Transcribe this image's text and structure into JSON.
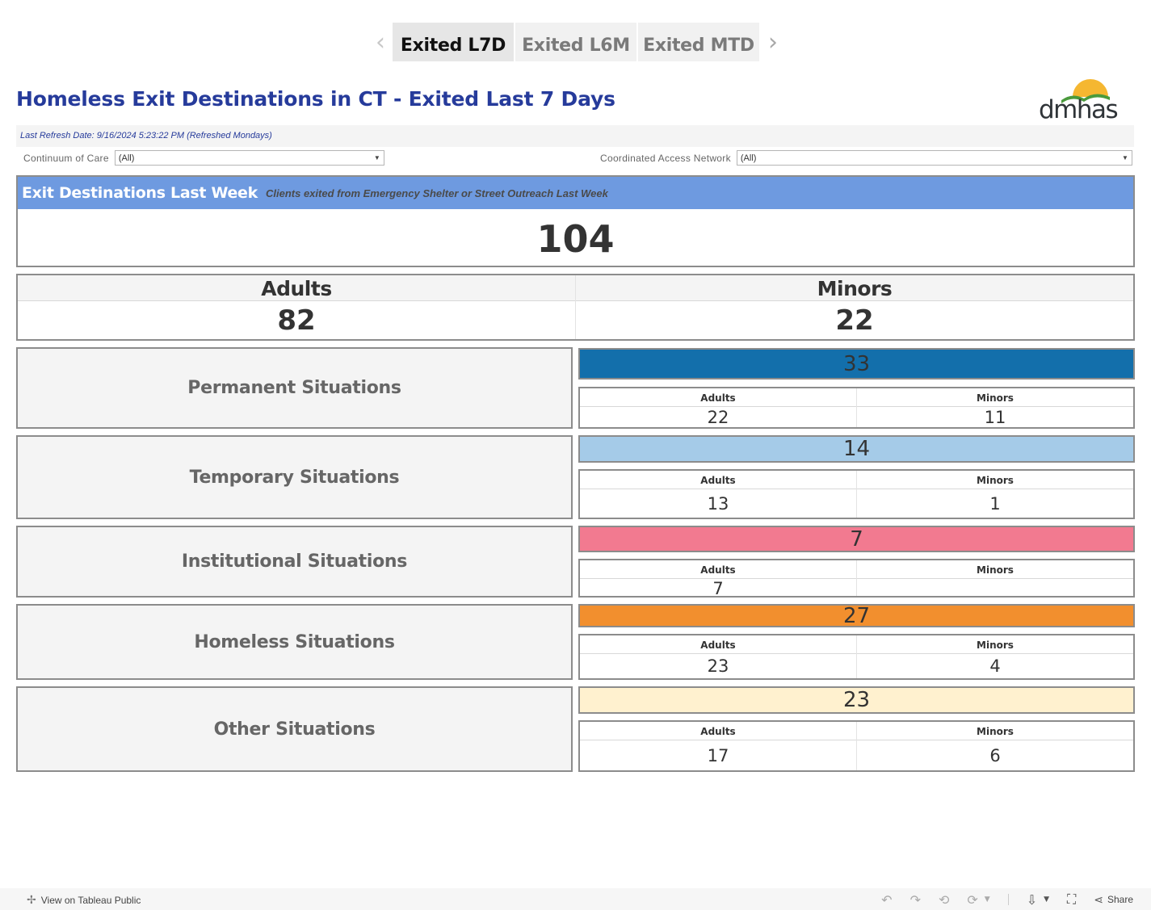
{
  "tabs": {
    "items": [
      {
        "label": "Exited L7D",
        "active": true
      },
      {
        "label": "Exited L6M",
        "active": false
      },
      {
        "label": "Exited MTD",
        "active": false
      }
    ],
    "prev_icon": "‹",
    "next_icon": "›"
  },
  "header": {
    "title": "Homeless Exit Destinations in CT - Exited Last 7 Days",
    "logo_text": "dmhas",
    "refresh_text": "Last Refresh Date: 9/16/2024 5:23:22 PM (Refreshed Mondays)"
  },
  "filters": {
    "continuum": {
      "label": "Continuum of Care",
      "value": "(All)"
    },
    "can": {
      "label": "Coordinated Access Network",
      "value": "(All)"
    },
    "arrow_icon": "▼"
  },
  "kpi": {
    "title": "Exit Destinations Last Week",
    "subtitle": "Clients exited from Emergency Shelter or Street Outreach Last Week",
    "value": "104"
  },
  "totals": {
    "adults_label": "Adults",
    "minors_label": "Minors",
    "adults_value": "82",
    "minors_value": "22"
  },
  "categories": [
    {
      "label": "Permanent Situations",
      "total": "33",
      "adults_label": "Adults",
      "minors_label": "Minors",
      "adults": "22",
      "minors": "11",
      "color": "#136fab"
    },
    {
      "label": "Temporary Situations",
      "total": "14",
      "adults_label": "Adults",
      "minors_label": "Minors",
      "adults": "13",
      "minors": "1",
      "color": "#a5cbe8"
    },
    {
      "label": "Institutional Situations",
      "total": "7",
      "adults_label": "Adults",
      "minors_label": "Minors",
      "adults": "7",
      "minors": "",
      "color": "#f27a90"
    },
    {
      "label": "Homeless Situations",
      "total": "27",
      "adults_label": "Adults",
      "minors_label": "Minors",
      "adults": "23",
      "minors": "4",
      "color": "#f28f2e"
    },
    {
      "label": "Other Situations",
      "total": "23",
      "adults_label": "Adults",
      "minors_label": "Minors",
      "adults": "17",
      "minors": "6",
      "color": "#fff1cf"
    }
  ],
  "footer": {
    "view_link": "View on Tableau Public",
    "share_label": "Share"
  }
}
